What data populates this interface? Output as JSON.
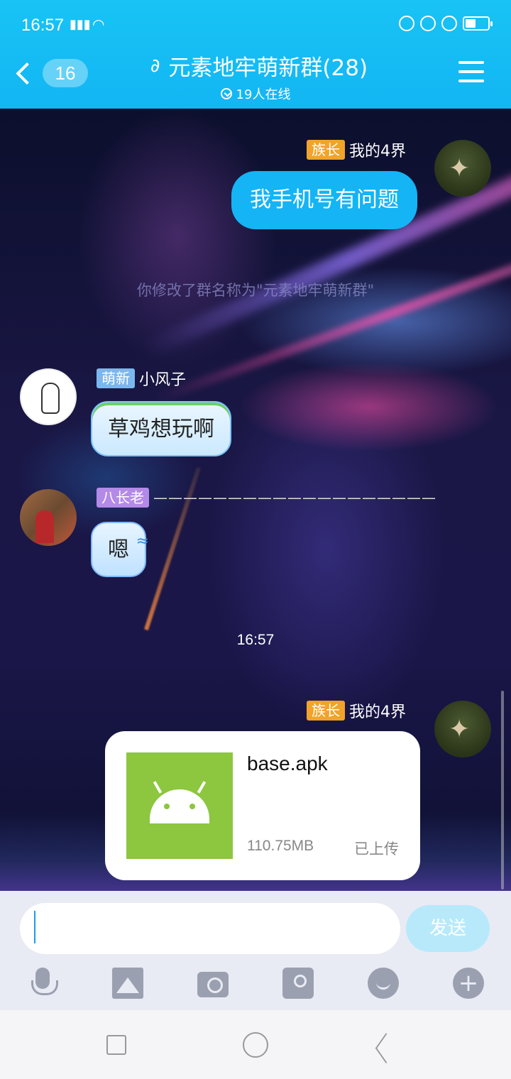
{
  "status_bar": {
    "time": "16:57",
    "signal": "E",
    "icons": [
      "eye-comfort-icon",
      "lock-rotation-icon",
      "alarm-icon",
      "battery-icon"
    ]
  },
  "header": {
    "back_count": "16",
    "title": "元素地牢萌新群(28)",
    "online": "19人在线",
    "colors": {
      "accent": "#14b4f5"
    }
  },
  "messages": [
    {
      "direction": "out",
      "tag": "族长",
      "sender": "我的4界",
      "text": "我手机号有问题"
    },
    {
      "direction": "system",
      "text": "你修改了群名称为\"元素地牢萌新群\""
    },
    {
      "direction": "in",
      "tag": "萌新",
      "sender": "小风子",
      "text": "草鸡想玩啊"
    },
    {
      "direction": "in",
      "tag": "八长老",
      "sender": "———————————————————",
      "text": "嗯"
    },
    {
      "direction": "timestamp",
      "text": "16:57"
    },
    {
      "direction": "out",
      "tag": "族长",
      "sender": "我的4界",
      "file": {
        "name": "base.apk",
        "size": "110.75MB",
        "status": "已上传"
      }
    }
  ],
  "input": {
    "value": "",
    "placeholder": "",
    "send_label": "发送"
  },
  "toolbar": [
    "mic-icon",
    "image-icon",
    "camera-icon",
    "red-packet-icon",
    "emoji-icon",
    "plus-icon"
  ],
  "navbar": [
    "recents-square-icon",
    "home-circle-icon",
    "back-triangle-icon"
  ]
}
